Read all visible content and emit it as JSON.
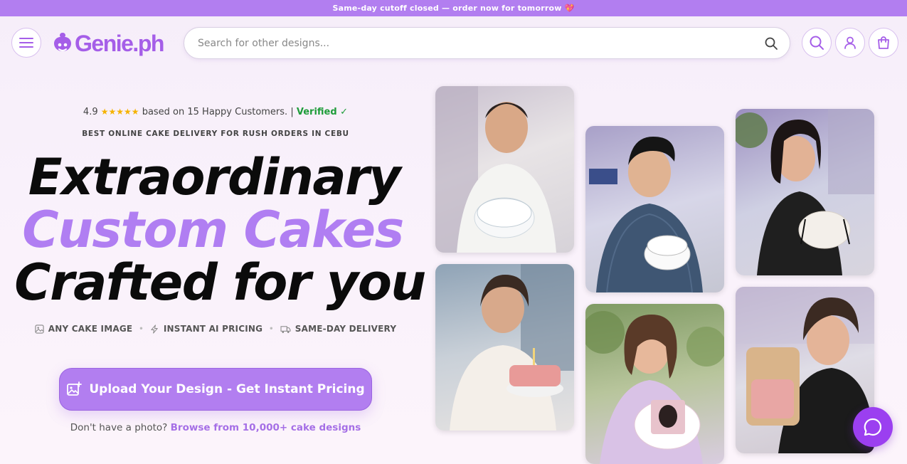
{
  "announcement": "Same-day cutoff closed — order now for tomorrow 💖",
  "header": {
    "logo_text": "Genie.ph",
    "search_placeholder": "Search for other designs...",
    "icons": [
      "menu-icon",
      "search-icon",
      "user-icon",
      "cart-icon"
    ]
  },
  "hero": {
    "rating_value": "4.9",
    "stars": "★★★★★",
    "rating_text": "based on 15 Happy Customers.",
    "separator": "|",
    "verified": "Verified ✓",
    "tagline": "BEST ONLINE CAKE DELIVERY FOR RUSH ORDERS IN CEBU",
    "headline_1": "Extraordinary",
    "headline_2": "Custom Cakes",
    "headline_3": "Crafted for you",
    "features": [
      {
        "label": "ANY CAKE IMAGE",
        "icon": "image-icon"
      },
      {
        "label": "INSTANT AI PRICING",
        "icon": "bolt-icon"
      },
      {
        "label": "SAME-DAY DELIVERY",
        "icon": "truck-icon"
      }
    ],
    "cta_label": "Upload Your Design - Get Instant Pricing",
    "browse_prefix": "Don't have a photo?",
    "browse_link": "Browse from 10,000+ cake designs"
  },
  "gallery": [
    {
      "caption": "Man holding Happy Birthday bento cake"
    },
    {
      "caption": "Man holding Happy Birthday Jakes cake"
    },
    {
      "caption": "Woman holding cake with bows"
    },
    {
      "caption": "Woman holding pink cake with candle"
    },
    {
      "caption": "Woman with photo cake"
    },
    {
      "caption": "Woman holding boxed bento cake"
    }
  ],
  "colors": {
    "brand": "#b27ef0",
    "logo": "#a55ee8",
    "verified": "#1f9d3a",
    "chat": "#9b3ff0"
  }
}
